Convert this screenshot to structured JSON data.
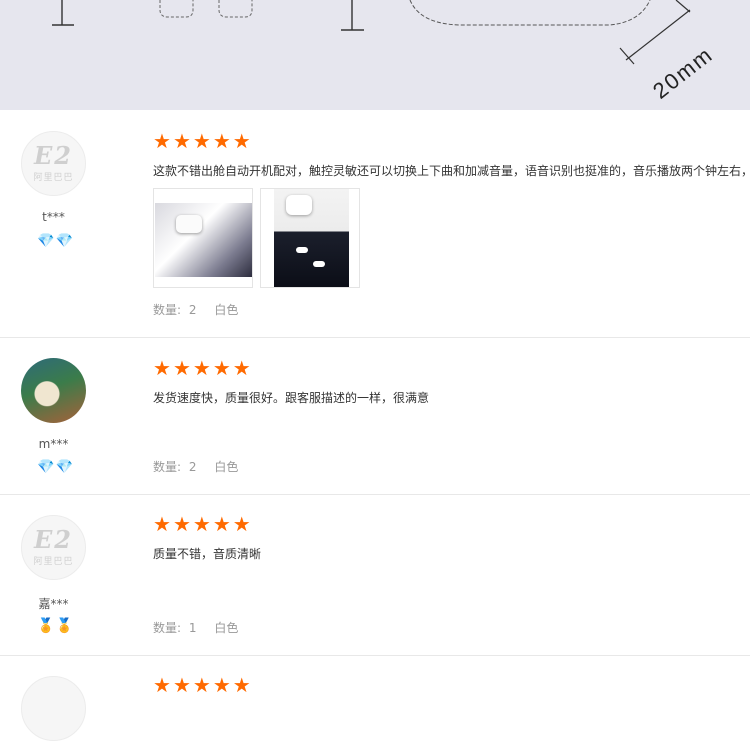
{
  "banner": {
    "size_label": "20mm"
  },
  "reviews": [
    {
      "user": "t***",
      "avatar": "default",
      "badge_icon": "diamond",
      "badges": [
        "💎",
        "💎"
      ],
      "stars": [
        "★",
        "★",
        "★",
        "★",
        "★"
      ],
      "comment": "这款不错出舱自动开机配对，触控灵敏还可以切换上下曲和加减音量，语音识别也挺准的，音乐播放两个钟左右，",
      "quantity_label": "数量:",
      "quantity": "2",
      "color": "白色",
      "images": [
        "earbud-case-photo",
        "earbuds-dark-photo"
      ]
    },
    {
      "user": "m***",
      "avatar": "photo",
      "badge_icon": "diamond",
      "badges": [
        "💎",
        "💎"
      ],
      "stars": [
        "★",
        "★",
        "★",
        "★",
        "★"
      ],
      "comment": "发货速度快，质量很好。跟客服描述的一样，很满意",
      "quantity_label": "数量:",
      "quantity": "2",
      "color": "白色"
    },
    {
      "user": "嘉***",
      "avatar": "default",
      "badge_icon": "crown",
      "badges": [
        "🏅",
        "🏅"
      ],
      "stars": [
        "★",
        "★",
        "★",
        "★",
        "★"
      ],
      "comment": "质量不错，音质清晰",
      "quantity_label": "数量:",
      "quantity": "1",
      "color": "白色"
    }
  ],
  "colors": {
    "star": "#ff6a00",
    "meta_text": "#999999",
    "banner_bg": "#e6e6ee"
  }
}
